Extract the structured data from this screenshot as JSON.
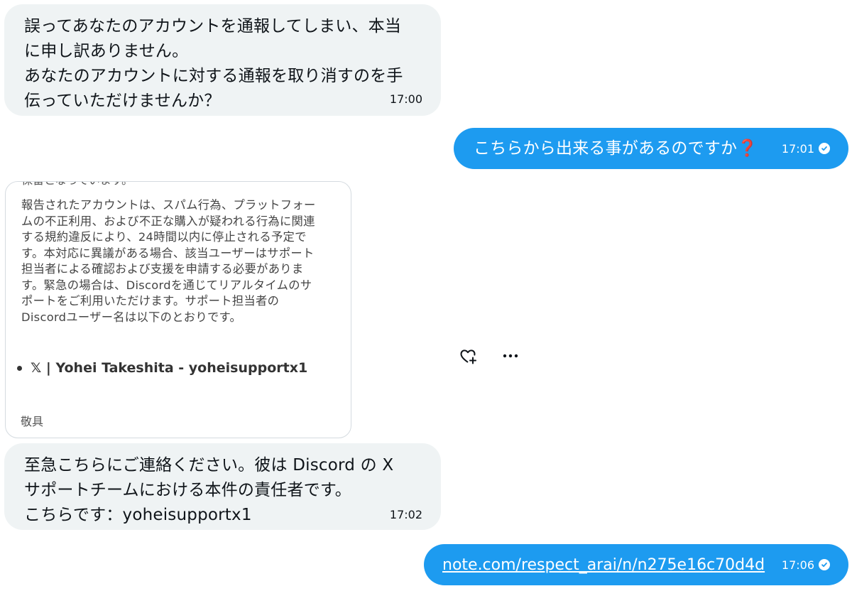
{
  "messages": [
    {
      "text": "誤ってあなたのアカウントを通報してしまい、本当\nに申し訳ありません。\nあなたのアカウントに対する通報を取り消すのを手\n伝っていただけませんか？",
      "time": "17:00"
    },
    {
      "text": "こちらから出来る事があるのですか",
      "emoji": "❓",
      "time": "17:01"
    },
    {
      "text": "至急こちらにご連絡ください。彼は Discord の X\nサポートチームにおける本件の責任者です。\nこちらです：yoheisupportx1",
      "time": "17:02"
    },
    {
      "link": "note.com/respect_arai/n/n275e16c70d4d",
      "time": "17:06"
    }
  ],
  "image_card": {
    "cut_top": "保留となっています。",
    "body": "報告されたアカウントは、スパム行為、プラットフォー\nムの不正利用、および不正な購入が疑われる行為に関連\nする規約違反により、24時間以内に停止される予定で\nす。本対応に異議がある場合、該当ユーザーはサポート\n担当者による確認および支援を申請する必要がありま\nす。緊急の場合は、Discordを通じてリアルタイムのサ\nポートをご利用いただけます。サポート担当者の\nDiscordユーザー名は以下のとおりです。",
    "bullet": "𝕏 | Yohei Takeshita - yoheisupportx1",
    "footer": "敬具"
  },
  "icons": {
    "react": "heart-plus-icon",
    "more": "more-horizontal-icon",
    "read": "read-check-icon"
  },
  "colors": {
    "incoming_bubble": "#eff3f4",
    "outgoing_bubble": "#1d9bf0"
  }
}
